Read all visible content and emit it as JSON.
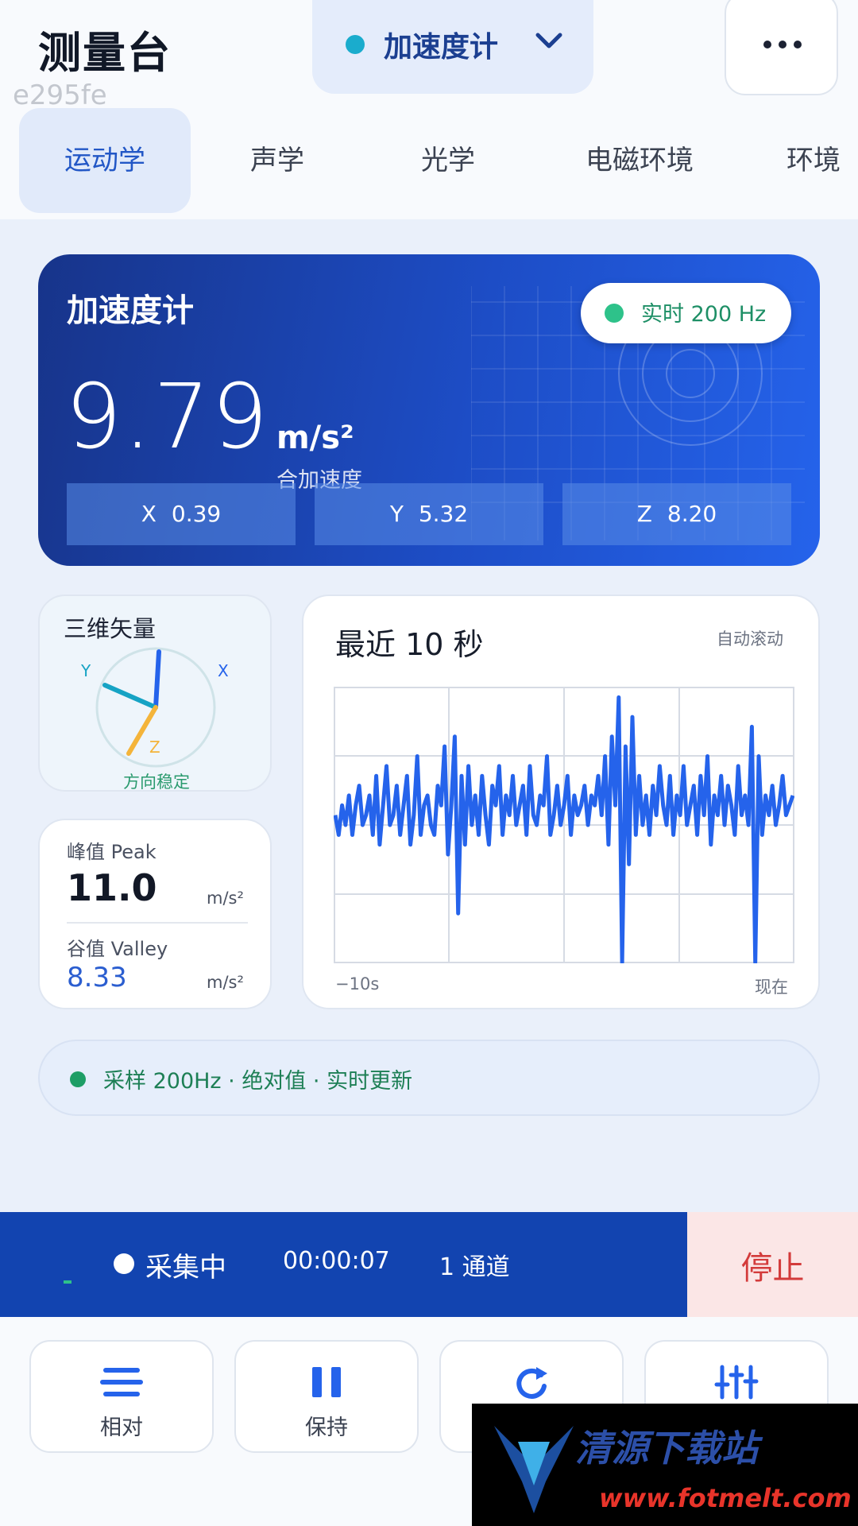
{
  "app": {
    "title": "测量台",
    "id": "e295fe"
  },
  "sensor_select": {
    "label": "加速度计"
  },
  "tabs": [
    {
      "label": "运动学",
      "active": true
    },
    {
      "label": "声学",
      "active": false
    },
    {
      "label": "光学",
      "active": false
    },
    {
      "label": "电磁环境",
      "active": false
    },
    {
      "label": "环境",
      "active": false
    }
  ],
  "hero": {
    "title": "加速度计",
    "live": "实时 200 Hz",
    "value": "9.79",
    "unit": "m/s²",
    "subtitle": "合加速度",
    "axes": [
      {
        "label": "X",
        "value": "0.39"
      },
      {
        "label": "Y",
        "value": "5.32"
      },
      {
        "label": "Z",
        "value": "8.20"
      }
    ]
  },
  "vector": {
    "title": "三维矢量",
    "x_label": "X",
    "y_label": "Y",
    "z_label": "Z",
    "status": "方向稳定"
  },
  "peak": {
    "peak_label": "峰值 Peak",
    "peak_value": "11.0",
    "peak_unit": "m/s²",
    "valley_label": "谷值 Valley",
    "valley_value": "8.33",
    "valley_unit": "m/s²"
  },
  "chart": {
    "title": "最近 10 秒",
    "hint": "自动滚动",
    "x_start": "−10s",
    "x_end": "现在"
  },
  "chart_data": {
    "type": "line",
    "title": "最近 10 秒",
    "x_range": [
      "−10s",
      "现在"
    ],
    "grid": true,
    "color": "#2563eb",
    "values": [
      9.8,
      9.6,
      9.9,
      9.7,
      10.0,
      9.6,
      9.9,
      10.1,
      9.7,
      9.8,
      10.0,
      9.6,
      10.2,
      9.5,
      9.9,
      10.3,
      9.7,
      9.8,
      10.1,
      9.6,
      9.9,
      10.2,
      9.5,
      9.8,
      10.4,
      9.6,
      9.9,
      10.0,
      9.7,
      9.6,
      10.1,
      9.9,
      10.5,
      9.4,
      9.9,
      10.6,
      8.8,
      10.2,
      9.5,
      10.3,
      9.7,
      10.0,
      9.6,
      10.2,
      9.8,
      9.5,
      10.1,
      9.9,
      10.3,
      9.6,
      10.0,
      9.8,
      10.2,
      9.7,
      9.9,
      10.1,
      9.6,
      10.3,
      9.8,
      9.7,
      10.0,
      9.9,
      10.4,
      9.6,
      9.8,
      10.1,
      9.7,
      9.9,
      10.2,
      9.6,
      10.0,
      9.8,
      9.9,
      10.1,
      9.7,
      10.0,
      9.9,
      10.2,
      9.8,
      10.4,
      9.5,
      10.6,
      9.9,
      11.0,
      8.3,
      10.5,
      9.3,
      10.8,
      9.6,
      10.2,
      9.7,
      10.0,
      9.6,
      10.1,
      9.8,
      10.3,
      9.9,
      9.7,
      10.2,
      9.6,
      10.0,
      9.8,
      10.3,
      9.7,
      9.9,
      10.1,
      9.6,
      10.2,
      9.8,
      10.4,
      9.5,
      10.0,
      9.8,
      10.2,
      9.7,
      10.1,
      9.9,
      9.6,
      10.3,
      9.8,
      10.0,
      9.7,
      10.7,
      8.3,
      10.4,
      9.6,
      10.0,
      9.8,
      10.1,
      9.7,
      9.9,
      10.2,
      9.8,
      9.9,
      10.0
    ],
    "ylim": [
      8.3,
      11.1
    ]
  },
  "status_strip": {
    "text": "采样 200Hz · 绝对值 · 实时更新"
  },
  "recording": {
    "state": "采集中",
    "time": "00:00:07",
    "channels": "1 通道",
    "stop": "停止"
  },
  "tools": [
    {
      "label": "相对",
      "icon": "relative-icon"
    },
    {
      "label": "保持",
      "icon": "pause-icon"
    },
    {
      "label": "",
      "icon": "reset-icon"
    },
    {
      "label": "",
      "icon": "sliders-icon"
    }
  ],
  "watermark": {
    "name": "清源下载站",
    "url": "www.fotmelt.com"
  },
  "colors": {
    "primary": "#1d4dc6",
    "accent_green": "#2ec28a",
    "stop_red": "#d33b3b"
  }
}
